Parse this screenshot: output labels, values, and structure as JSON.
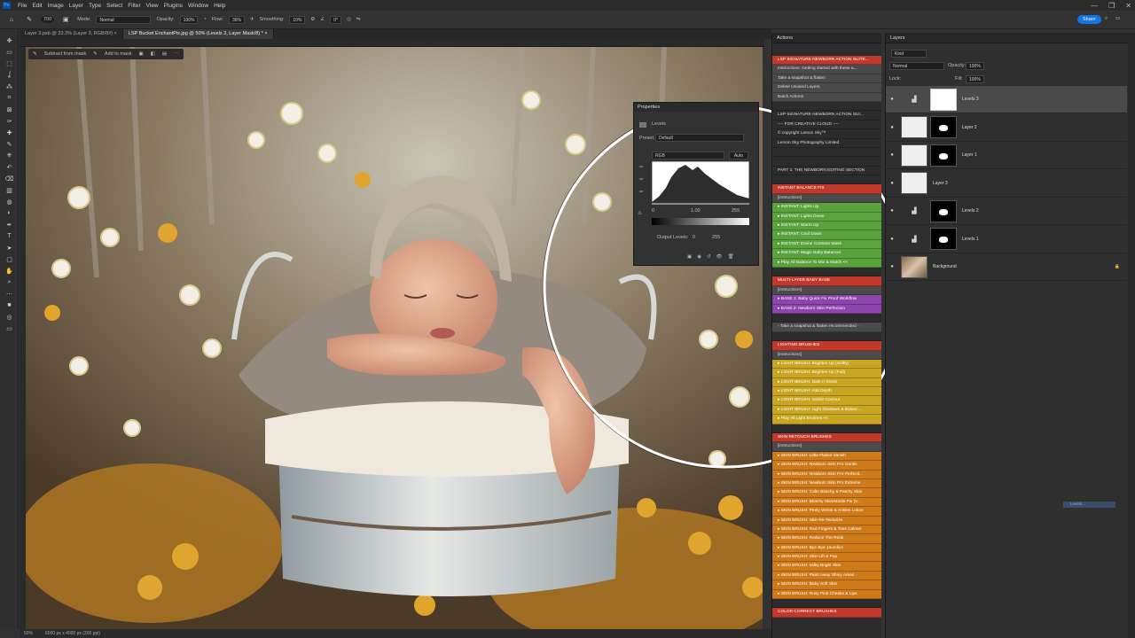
{
  "menu": {
    "logo": "Ps",
    "items": [
      "File",
      "Edit",
      "Image",
      "Layer",
      "Type",
      "Select",
      "Filter",
      "View",
      "Plugins",
      "Window",
      "Help"
    ]
  },
  "window_controls": [
    "—",
    "❐",
    "✕"
  ],
  "options_bar": {
    "mode_label": "Mode:",
    "mode_value": "Normal",
    "opacity_label": "Opacity:",
    "opacity_value": "100%",
    "flow_label": "Flow:",
    "flow_value": "36%",
    "smoothing_label": "Smoothing:",
    "smoothing_value": "10%",
    "angle_value": "0°",
    "brush_size": "700",
    "share_label": "Share"
  },
  "doc_tabs": [
    {
      "label": "Layer 3.psb @ 33.3% (Layer 3, RGB/8#)",
      "close": "×",
      "active": false
    },
    {
      "label": "LSP Bucket EnchantPix.jpg @ 50% (Levels 3, Layer Mask/8) *",
      "close": "×",
      "active": true
    }
  ],
  "canvas_toolbar": {
    "subtract_label": "Subtract from mask",
    "add_label": "Add to mask"
  },
  "status": {
    "zoom": "50%",
    "size": "6000 px x 4000 px (300 ppi)"
  },
  "properties": {
    "title": "Properties",
    "subtitle": "Levels",
    "preset_label": "Preset:",
    "preset_value": "Default",
    "channel": "RGB",
    "auto_label": "Auto",
    "input_black": "0",
    "input_gamma": "1.00",
    "input_white": "255",
    "output_label": "Output Levels:",
    "output_black": "0",
    "output_white": "255"
  },
  "actions_panel": {
    "title": "Actions",
    "items": [
      {
        "label": "LSP SIGNATURE NEWBORN ACTION SUITE...",
        "bg": "#c0392b",
        "color": "#ffffff"
      },
      {
        "label": "Instructions: Getting started with these a...",
        "bg": "#4a4a4a",
        "color": "#dddddd"
      },
      {
        "label": "Take a snapshot & flatten",
        "bg": "#4a4a4a",
        "color": "#dddddd"
      },
      {
        "label": "Delete Unused Layers",
        "bg": "#4a4a4a",
        "color": "#dddddd"
      },
      {
        "label": "Batch Actions",
        "bg": "#4a4a4a",
        "color": "#dddddd"
      },
      {
        "label": "",
        "bg": "#2c2c2c",
        "color": "#dddddd"
      },
      {
        "label": "LSP SIGNATURE NEWBORN ACTION SUI...",
        "bg": "#2c2c2c",
        "color": "#dddddd"
      },
      {
        "label": "---- FOR CREATIVE CLOUD ----",
        "bg": "#2c2c2c",
        "color": "#dddddd"
      },
      {
        "label": "© copyright Lemon Sky™",
        "bg": "#2c2c2c",
        "color": "#dddddd"
      },
      {
        "label": "Lemon Sky Photography Limited",
        "bg": "#2c2c2c",
        "color": "#dddddd"
      },
      {
        "label": "",
        "bg": "#2c2c2c",
        "color": "#dddddd"
      },
      {
        "label": "",
        "bg": "#2c2c2c",
        "color": "#dddddd"
      },
      {
        "label": "PART 1: THE NEWBORN EDITING SECTION",
        "bg": "#2c2c2c",
        "color": "#dddddd"
      },
      {
        "label": "",
        "bg": "#2c2c2c",
        "color": "#dddddd"
      },
      {
        "label": "INSTANT BALANCE FIX",
        "bg": "#c0392b",
        "color": "#ffffff"
      },
      {
        "label": "[instructions]",
        "bg": "#4a4a4a",
        "color": "#dddddd"
      },
      {
        "label": "▸ INSTANT: Lights Up",
        "bg": "#5aa23c",
        "color": "#ffffff"
      },
      {
        "label": "▸ INSTANT: Lights Down",
        "bg": "#5aa23c",
        "color": "#ffffff"
      },
      {
        "label": "▸ INSTANT: Warm Up",
        "bg": "#5aa23c",
        "color": "#ffffff"
      },
      {
        "label": "▸ INSTANT: Cool Down",
        "bg": "#5aa23c",
        "color": "#ffffff"
      },
      {
        "label": "▸ INSTANT: Divine Contrast Wash",
        "bg": "#5aa23c",
        "color": "#ffffff"
      },
      {
        "label": "▸ INSTANT: Magic Baby Balancer",
        "bg": "#5aa23c",
        "color": "#ffffff"
      },
      {
        "label": "▸ Play All Balance To Mix & Match <<",
        "bg": "#5aa23c",
        "color": "#ffffff"
      },
      {
        "label": "",
        "bg": "#2c2c2c",
        "color": "#dddddd"
      },
      {
        "label": "MULTI-LAYER BABY BASE",
        "bg": "#c0392b",
        "color": "#ffffff"
      },
      {
        "label": "[instructions]",
        "bg": "#4a4a4a",
        "color": "#dddddd"
      },
      {
        "label": "▸ BASE 1: Baby Quick Fix Proof Workflow",
        "bg": "#8e44ad",
        "color": "#ffffff"
      },
      {
        "label": "▸ BASE 2: Newborn Skin Perfection",
        "bg": "#8e44ad",
        "color": "#ffffff"
      },
      {
        "label": "",
        "bg": "#2c2c2c",
        "color": "#dddddd"
      },
      {
        "label": "- Take a snapshot & flatten recommended -",
        "bg": "#4a4a4a",
        "color": "#dddddd"
      },
      {
        "label": "",
        "bg": "#2c2c2c",
        "color": "#dddddd"
      },
      {
        "label": "LIGHTING BRUSHES",
        "bg": "#c0392b",
        "color": "#ffffff"
      },
      {
        "label": "[instructions]",
        "bg": "#4a4a4a",
        "color": "#dddddd"
      },
      {
        "label": "▸ LIGHT BRUSH: Brighten Up (Softly)",
        "bg": "#c8a622",
        "color": "#ffffff"
      },
      {
        "label": "▸ LIGHT BRUSH: Brighten Up (Full)",
        "bg": "#c8a622",
        "color": "#ffffff"
      },
      {
        "label": "▸ LIGHT BRUSH: Dark n' Down",
        "bg": "#c8a622",
        "color": "#ffffff"
      },
      {
        "label": "▸ LIGHT BRUSH: Add Depth",
        "bg": "#c8a622",
        "color": "#ffffff"
      },
      {
        "label": "▸ LIGHT BRUSH: Subtle Contour",
        "bg": "#c8a622",
        "color": "#ffffff"
      },
      {
        "label": "▸ LIGHT BRUSH: Light Shadows & Balanc...",
        "bg": "#c8a622",
        "color": "#ffffff"
      },
      {
        "label": "▸ Play All Light Brushes <<",
        "bg": "#c8a622",
        "color": "#ffffff"
      },
      {
        "label": "",
        "bg": "#2c2c2c",
        "color": "#dddddd"
      },
      {
        "label": "SKIN RETOUCH BRUSHES",
        "bg": "#c0392b",
        "color": "#ffffff"
      },
      {
        "label": "[instructions]",
        "bg": "#4a4a4a",
        "color": "#dddddd"
      },
      {
        "label": "▸ SKIN BRUSH: Little Flakes Vanish",
        "bg": "#cf7a19",
        "color": "#ffffff"
      },
      {
        "label": "▸ SKIN BRUSH: Newborn Skin Pro Gentle",
        "bg": "#cf7a19",
        "color": "#ffffff"
      },
      {
        "label": "▸ SKIN BRUSH: Newborn Skin Pro Perfecti...",
        "bg": "#cf7a19",
        "color": "#ffffff"
      },
      {
        "label": "▸ SKIN BRUSH: Newborn Skin Pro Extreme",
        "bg": "#cf7a19",
        "color": "#ffffff"
      },
      {
        "label": "▸ SKIN BRUSH: Calm Blotchy & Patchy Skin",
        "bg": "#cf7a19",
        "color": "#ffffff"
      },
      {
        "label": "▸ SKIN BRUSH: Blotchy Skin/Mottle Fix (V...",
        "bg": "#cf7a19",
        "color": "#ffffff"
      },
      {
        "label": "▸ SKIN BRUSH: Peely Wrists & Ankles Lotion",
        "bg": "#cf7a19",
        "color": "#ffffff"
      },
      {
        "label": "▸ SKIN BRUSH: Skin Re-Texturize",
        "bg": "#cf7a19",
        "color": "#ffffff"
      },
      {
        "label": "▸ SKIN BRUSH: Red Fingers & Toes Calmer",
        "bg": "#cf7a19",
        "color": "#ffffff"
      },
      {
        "label": "▸ SKIN BRUSH: Reduce The Reds",
        "bg": "#cf7a19",
        "color": "#ffffff"
      },
      {
        "label": "▸ SKIN BRUSH: Bye Bye Jaundice",
        "bg": "#cf7a19",
        "color": "#ffffff"
      },
      {
        "label": "▸ SKIN BRUSH: Skin Lift & Pop",
        "bg": "#cf7a19",
        "color": "#ffffff"
      },
      {
        "label": "▸ SKIN BRUSH: Milky Bright Skin",
        "bg": "#cf7a19",
        "color": "#ffffff"
      },
      {
        "label": "▸ SKIN BRUSH: Paint Away Shiny Areas",
        "bg": "#cf7a19",
        "color": "#ffffff"
      },
      {
        "label": "▸ SKIN BRUSH: Baby Soft Skin",
        "bg": "#cf7a19",
        "color": "#ffffff"
      },
      {
        "label": "▸ SKIN BRUSH: Rosy Pink Cheeks & Lips",
        "bg": "#cf7a19",
        "color": "#ffffff"
      },
      {
        "label": "",
        "bg": "#2c2c2c",
        "color": "#dddddd"
      },
      {
        "label": "COLOR CORRECT BRUSHES",
        "bg": "#c0392b",
        "color": "#ffffff"
      }
    ]
  },
  "layers_panel": {
    "title": "Layers",
    "filter_value": "Kind",
    "blend_value": "Normal",
    "opacity_label": "Opacity:",
    "opacity_value": "100%",
    "lock_label": "Lock:",
    "fill_label": "Fill:",
    "fill_value": "100%",
    "rows": [
      {
        "name": "Levels 3",
        "kind": "adjustment",
        "mask": "white",
        "selected": true
      },
      {
        "name": "Layer 2",
        "kind": "pixel",
        "mask": "black",
        "selected": false
      },
      {
        "name": "Layer 1",
        "kind": "pixel",
        "mask": "blob",
        "selected": false
      },
      {
        "name": "Layer 3",
        "kind": "pixel",
        "mask": "",
        "selected": false
      },
      {
        "name": "Levels 2",
        "kind": "adjustment",
        "mask": "streak",
        "selected": false
      },
      {
        "name": "Levels 1",
        "kind": "adjustment",
        "mask": "spots",
        "selected": false
      },
      {
        "name": "Background",
        "kind": "photo",
        "mask": "",
        "selected": false
      }
    ],
    "drag_label": "Levels..."
  }
}
